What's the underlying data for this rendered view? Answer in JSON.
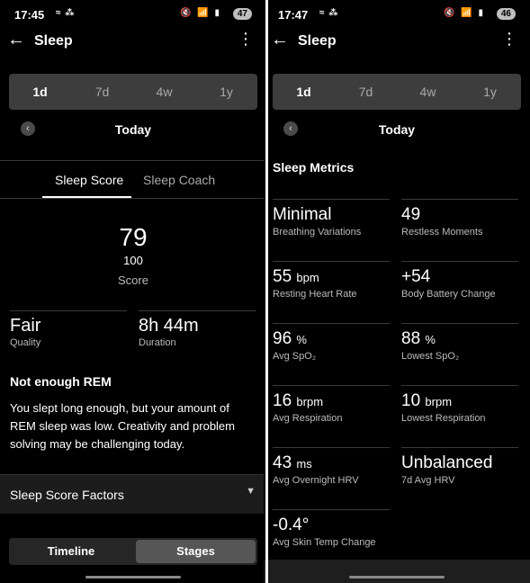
{
  "left": {
    "status": {
      "time": "17:45",
      "notification_icons": "≈ ⁂",
      "right_icons": "🔇 📶 ▮",
      "battery": "47"
    },
    "app": {
      "title": "Sleep"
    },
    "range": [
      "1d",
      "7d",
      "4w",
      "1y"
    ],
    "date": "Today",
    "tabs": {
      "score": "Sleep Score",
      "coach": "Sleep Coach"
    },
    "score": {
      "value": "79",
      "max": "100",
      "label": "Score"
    },
    "stats": [
      {
        "value": "Fair",
        "label": "Quality"
      },
      {
        "value": "8h 44m",
        "label": "Duration"
      }
    ],
    "insight": {
      "title": "Not enough REM",
      "text": "You slept long enough, but your amount of REM sleep was low. Creativity and problem solving may be challenging today."
    },
    "factors_label": "Sleep Score Factors",
    "toggle": {
      "timeline": "Timeline",
      "stages": "Stages"
    }
  },
  "right": {
    "status": {
      "time": "17:47",
      "notification_icons": "≈ ⁂",
      "right_icons": "🔇 📶 ▮",
      "battery": "46"
    },
    "app": {
      "title": "Sleep"
    },
    "range": [
      "1d",
      "7d",
      "4w",
      "1y"
    ],
    "date": "Today",
    "metrics_title": "Sleep Metrics",
    "metrics": [
      {
        "value": "Minimal",
        "unit": "",
        "label": "Breathing Variations"
      },
      {
        "value": "49",
        "unit": "",
        "label": "Restless Moments"
      },
      {
        "value": "55",
        "unit": "bpm",
        "label": "Resting Heart Rate"
      },
      {
        "value": "+54",
        "unit": "",
        "label": "Body Battery Change"
      },
      {
        "value": "96",
        "unit": "%",
        "label": "Avg SpO₂"
      },
      {
        "value": "88",
        "unit": "%",
        "label": "Lowest SpO₂"
      },
      {
        "value": "16",
        "unit": "brpm",
        "label": "Avg Respiration"
      },
      {
        "value": "10",
        "unit": "brpm",
        "label": "Lowest Respiration"
      },
      {
        "value": "43",
        "unit": "ms",
        "label": "Avg Overnight HRV"
      },
      {
        "value": "Unbalanced",
        "unit": "",
        "label": "7d Avg HRV"
      },
      {
        "value": "-0.4°",
        "unit": "",
        "label": "Avg Skin Temp Change"
      }
    ]
  }
}
